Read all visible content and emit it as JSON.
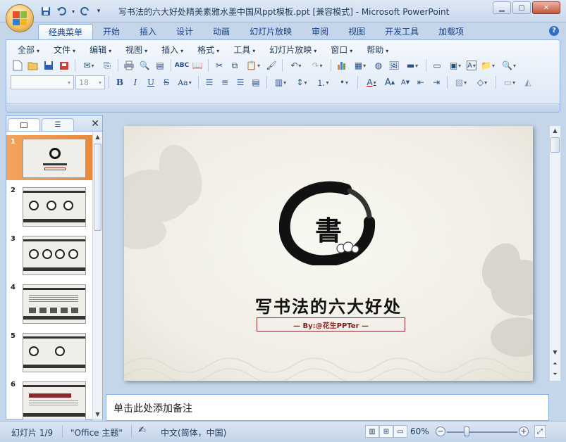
{
  "window": {
    "title": "写书法的六大好处精美素雅水墨中国风ppt模板.ppt [兼容模式] - Microsoft PowerPoint"
  },
  "ribbon_tabs": [
    {
      "label": "经典菜单",
      "active": true
    },
    {
      "label": "开始"
    },
    {
      "label": "插入"
    },
    {
      "label": "设计"
    },
    {
      "label": "动画"
    },
    {
      "label": "幻灯片放映"
    },
    {
      "label": "审阅"
    },
    {
      "label": "视图"
    },
    {
      "label": "开发工具"
    },
    {
      "label": "加载项"
    }
  ],
  "classic_menu": [
    "全部",
    "文件",
    "编辑",
    "视图",
    "插入",
    "格式",
    "工具",
    "幻灯片放映",
    "窗口",
    "帮助"
  ],
  "font": {
    "size": "18"
  },
  "slides": [
    {
      "number": "1",
      "selected": true
    },
    {
      "number": "2"
    },
    {
      "number": "3"
    },
    {
      "number": "4"
    },
    {
      "number": "5"
    },
    {
      "number": "6"
    }
  ],
  "slide": {
    "seal_char": "書",
    "title": "写书法的六大好处",
    "subtitle": "— By:@花生PPTer —"
  },
  "notes": {
    "placeholder": "单击此处添加备注"
  },
  "status": {
    "slide_info": "幻灯片 1/9",
    "theme": "\"Office 主题\"",
    "language": "中文(简体，中国)",
    "zoom": "60%",
    "zoom_value": 60
  },
  "colors": {
    "accent_orange": "#e98a3a",
    "subtitle_red": "#8b1d1d",
    "ribbon_border": "#8db2e3"
  }
}
